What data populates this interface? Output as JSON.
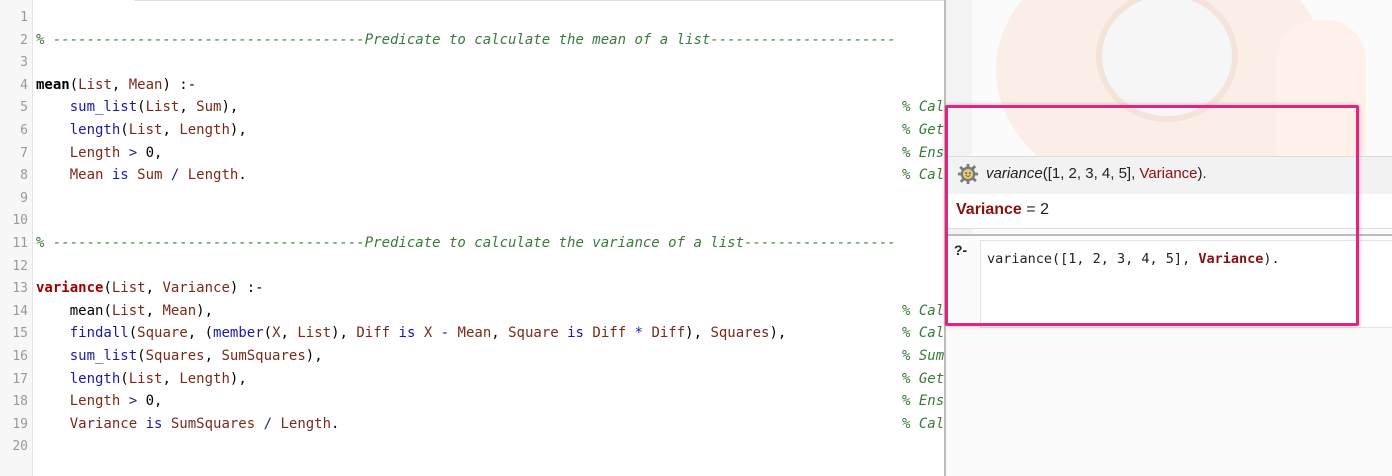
{
  "editor": {
    "lines": [
      {
        "n": "1",
        "parts": []
      },
      {
        "n": "2",
        "parts": [
          {
            "t": "% -------------------------------------Predicate to calculate the mean of a list----------------------",
            "c": "c-green"
          }
        ]
      },
      {
        "n": "3",
        "parts": []
      },
      {
        "n": "4",
        "parts": [
          {
            "t": "mean",
            "c": "c-head"
          },
          {
            "t": "(",
            "c": "c-punct"
          },
          {
            "t": "List",
            "c": "c-var"
          },
          {
            "t": ", ",
            "c": "c-punct"
          },
          {
            "t": "Mean",
            "c": "c-var"
          },
          {
            "t": ") :-",
            "c": "c-punct"
          }
        ]
      },
      {
        "n": "5",
        "parts": [
          {
            "t": "    "
          },
          {
            "t": "sum_list",
            "c": "c-builtin"
          },
          {
            "t": "(",
            "c": "c-punct"
          },
          {
            "t": "List",
            "c": "c-var"
          },
          {
            "t": ", ",
            "c": "c-punct"
          },
          {
            "t": "Sum",
            "c": "c-var"
          },
          {
            "t": "),",
            "c": "c-punct"
          }
        ],
        "cmt": "% Cal"
      },
      {
        "n": "6",
        "parts": [
          {
            "t": "    "
          },
          {
            "t": "length",
            "c": "c-builtin"
          },
          {
            "t": "(",
            "c": "c-punct"
          },
          {
            "t": "List",
            "c": "c-var"
          },
          {
            "t": ", ",
            "c": "c-punct"
          },
          {
            "t": "Length",
            "c": "c-var"
          },
          {
            "t": "),",
            "c": "c-punct"
          }
        ],
        "cmt": "% Get"
      },
      {
        "n": "7",
        "parts": [
          {
            "t": "    "
          },
          {
            "t": "Length",
            "c": "c-var"
          },
          {
            "t": " > ",
            "c": "c-op"
          },
          {
            "t": "0",
            "c": "c-num"
          },
          {
            "t": ",",
            "c": "c-punct"
          }
        ],
        "cmt": "% Ens"
      },
      {
        "n": "8",
        "parts": [
          {
            "t": "    "
          },
          {
            "t": "Mean",
            "c": "c-var"
          },
          {
            "t": " is ",
            "c": "c-op"
          },
          {
            "t": "Sum",
            "c": "c-var"
          },
          {
            "t": " / ",
            "c": "c-op"
          },
          {
            "t": "Length",
            "c": "c-var"
          },
          {
            "t": ".",
            "c": "c-punct"
          }
        ],
        "cmt": "% Cal"
      },
      {
        "n": "9",
        "parts": []
      },
      {
        "n": "10",
        "parts": []
      },
      {
        "n": "11",
        "parts": [
          {
            "t": "% -------------------------------------Predicate to calculate the variance of a list------------------",
            "c": "c-green"
          }
        ]
      },
      {
        "n": "12",
        "parts": []
      },
      {
        "n": "13",
        "parts": [
          {
            "t": "variance",
            "c": "c-headred"
          },
          {
            "t": "(",
            "c": "c-punct"
          },
          {
            "t": "List",
            "c": "c-var"
          },
          {
            "t": ", ",
            "c": "c-punct"
          },
          {
            "t": "Variance",
            "c": "c-var"
          },
          {
            "t": ") :-",
            "c": "c-punct"
          }
        ]
      },
      {
        "n": "14",
        "parts": [
          {
            "t": "    "
          },
          {
            "t": "mean",
            "c": "c-punct"
          },
          {
            "t": "(",
            "c": "c-punct"
          },
          {
            "t": "List",
            "c": "c-var"
          },
          {
            "t": ", ",
            "c": "c-punct"
          },
          {
            "t": "Mean",
            "c": "c-var"
          },
          {
            "t": "),",
            "c": "c-punct"
          }
        ],
        "cmt": "% Cal"
      },
      {
        "n": "15",
        "parts": [
          {
            "t": "    "
          },
          {
            "t": "findall",
            "c": "c-builtin"
          },
          {
            "t": "(",
            "c": "c-punct"
          },
          {
            "t": "Square",
            "c": "c-var"
          },
          {
            "t": ", (",
            "c": "c-punct"
          },
          {
            "t": "member",
            "c": "c-builtin"
          },
          {
            "t": "(",
            "c": "c-punct"
          },
          {
            "t": "X",
            "c": "c-var"
          },
          {
            "t": ", ",
            "c": "c-punct"
          },
          {
            "t": "List",
            "c": "c-var"
          },
          {
            "t": "), ",
            "c": "c-punct"
          },
          {
            "t": "Diff",
            "c": "c-var"
          },
          {
            "t": " is ",
            "c": "c-op"
          },
          {
            "t": "X",
            "c": "c-var"
          },
          {
            "t": " - ",
            "c": "c-op"
          },
          {
            "t": "Mean",
            "c": "c-var"
          },
          {
            "t": ", ",
            "c": "c-punct"
          },
          {
            "t": "Square",
            "c": "c-var"
          },
          {
            "t": " is ",
            "c": "c-op"
          },
          {
            "t": "Diff",
            "c": "c-var"
          },
          {
            "t": " * ",
            "c": "c-op"
          },
          {
            "t": "Diff",
            "c": "c-var"
          },
          {
            "t": "), ",
            "c": "c-punct"
          },
          {
            "t": "Squares",
            "c": "c-var"
          },
          {
            "t": "),",
            "c": "c-punct"
          }
        ],
        "cmt": "% Cal"
      },
      {
        "n": "16",
        "parts": [
          {
            "t": "    "
          },
          {
            "t": "sum_list",
            "c": "c-builtin"
          },
          {
            "t": "(",
            "c": "c-punct"
          },
          {
            "t": "Squares",
            "c": "c-var"
          },
          {
            "t": ", ",
            "c": "c-punct"
          },
          {
            "t": "SumSquares",
            "c": "c-var"
          },
          {
            "t": "),",
            "c": "c-punct"
          }
        ],
        "cmt": "% Sum"
      },
      {
        "n": "17",
        "parts": [
          {
            "t": "    "
          },
          {
            "t": "length",
            "c": "c-builtin"
          },
          {
            "t": "(",
            "c": "c-punct"
          },
          {
            "t": "List",
            "c": "c-var"
          },
          {
            "t": ", ",
            "c": "c-punct"
          },
          {
            "t": "Length",
            "c": "c-var"
          },
          {
            "t": "),",
            "c": "c-punct"
          }
        ],
        "cmt": "% Get"
      },
      {
        "n": "18",
        "parts": [
          {
            "t": "    "
          },
          {
            "t": "Length",
            "c": "c-var"
          },
          {
            "t": " > ",
            "c": "c-op"
          },
          {
            "t": "0",
            "c": "c-num"
          },
          {
            "t": ",",
            "c": "c-punct"
          }
        ],
        "cmt": "% Ens"
      },
      {
        "n": "19",
        "parts": [
          {
            "t": "    "
          },
          {
            "t": "Variance",
            "c": "c-var"
          },
          {
            "t": " is ",
            "c": "c-op"
          },
          {
            "t": "SumSquares",
            "c": "c-var"
          },
          {
            "t": " / ",
            "c": "c-op"
          },
          {
            "t": "Length",
            "c": "c-var"
          },
          {
            "t": ".",
            "c": "c-punct"
          }
        ],
        "cmt": "% Cal"
      },
      {
        "n": "20",
        "parts": []
      }
    ]
  },
  "query": {
    "icon": "gear-icon",
    "fn": "variance",
    "args": "([1, 2, 3, 4, 5], ",
    "var": "Variance",
    "tail": ")."
  },
  "answer": {
    "var": "Variance",
    "rest": " = 2"
  },
  "input": {
    "prompt": "?-",
    "before": "variance([1, 2, 3, 4, 5], ",
    "var": "Variance",
    "after": ")."
  },
  "colors": {
    "highlight": "#e0257e",
    "comment": "#3a7a3a",
    "builtin": "#1a1aa6",
    "variable": "#7a2a1a"
  }
}
